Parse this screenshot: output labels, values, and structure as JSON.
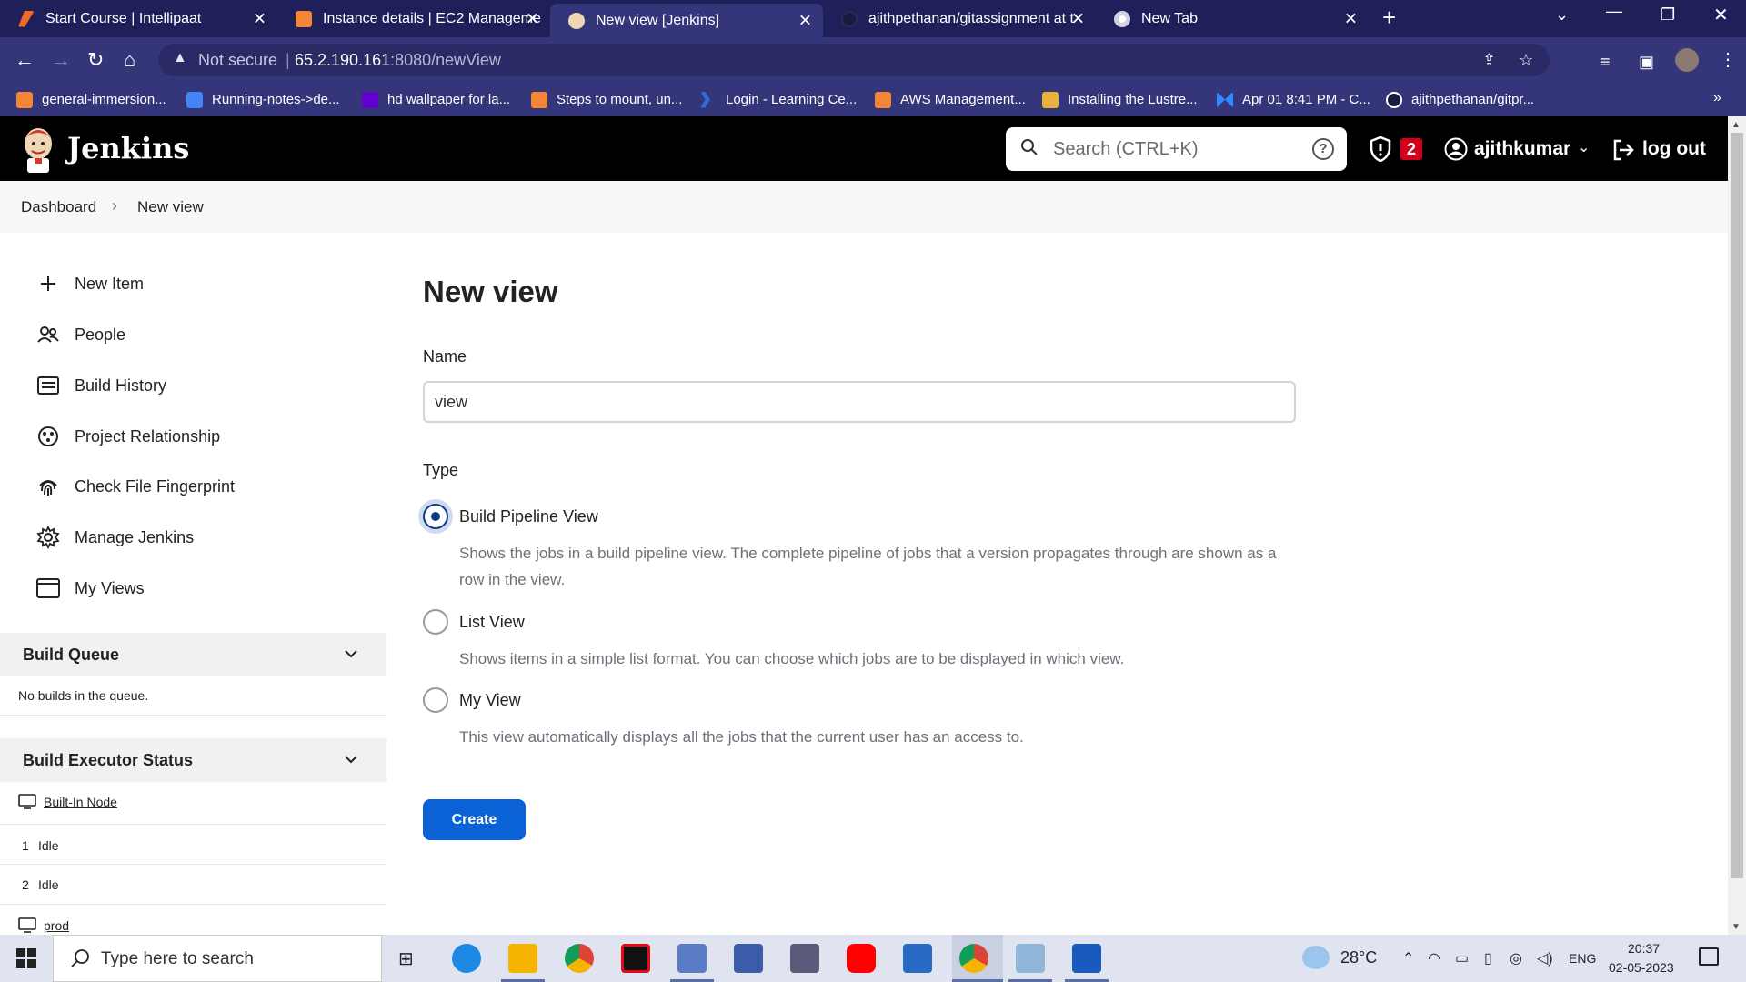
{
  "browser": {
    "tabs": [
      {
        "title": "Start Course | Intellipaat",
        "active": false,
        "icon": "intellipaat-icon"
      },
      {
        "title": "Instance details | EC2 Manageme",
        "active": false,
        "icon": "aws-icon"
      },
      {
        "title": "New view [Jenkins]",
        "active": true,
        "icon": "jenkins-icon"
      },
      {
        "title": "ajithpethanan/gitassignment at t",
        "active": false,
        "icon": "github-icon"
      },
      {
        "title": "New Tab",
        "active": false,
        "icon": "chrome-icon"
      }
    ],
    "address": {
      "security": "Not secure",
      "host": "65.2.190.161",
      "path": ":8080/newView"
    },
    "bookmarks": [
      {
        "label": "general-immersion...",
        "icon": "aws-icon"
      },
      {
        "label": "Running-notes->de...",
        "icon": "docs-icon"
      },
      {
        "label": "hd wallpaper for la...",
        "icon": "yahoo-icon"
      },
      {
        "label": "Steps to mount, un...",
        "icon": "aws-icon"
      },
      {
        "label": "Login - Learning Ce...",
        "icon": "x-icon"
      },
      {
        "label": "AWS Management...",
        "icon": "aws-icon"
      },
      {
        "label": "Installing the Lustre...",
        "icon": "package-icon"
      },
      {
        "label": "Apr 01 8:41 PM - C...",
        "icon": "zoom-icon"
      },
      {
        "label": "ajithpethanan/gitpr...",
        "icon": "github-icon"
      }
    ]
  },
  "jenkins": {
    "title": "Jenkins",
    "search_placeholder": "Search (CTRL+K)",
    "security_count": "2",
    "username": "ajithkumar",
    "logout": "log out"
  },
  "breadcrumb": [
    "Dashboard",
    "New view"
  ],
  "sidebar": {
    "items": [
      {
        "label": "New Item",
        "icon": "plus-icon"
      },
      {
        "label": "People",
        "icon": "people-icon"
      },
      {
        "label": "Build History",
        "icon": "history-icon"
      },
      {
        "label": "Project Relationship",
        "icon": "relationship-icon"
      },
      {
        "label": "Check File Fingerprint",
        "icon": "fingerprint-icon"
      },
      {
        "label": "Manage Jenkins",
        "icon": "gear-icon"
      },
      {
        "label": "My Views",
        "icon": "window-icon"
      }
    ],
    "build_queue": {
      "title": "Build Queue",
      "empty": "No builds in the queue."
    },
    "executors": {
      "title": "Build Executor Status",
      "nodes": [
        "Built-In Node",
        "prod"
      ],
      "slots": [
        {
          "num": "1",
          "status": "Idle"
        },
        {
          "num": "2",
          "status": "Idle"
        }
      ]
    }
  },
  "main": {
    "title": "New view",
    "name_label": "Name",
    "name_value": "view",
    "type_label": "Type",
    "options": [
      {
        "label": "Build Pipeline View",
        "checked": true,
        "desc": "Shows the jobs in a build pipeline view. The complete pipeline of jobs that a version propagates through are shown as a row in the view."
      },
      {
        "label": "List View",
        "checked": false,
        "desc": "Shows items in a simple list format. You can choose which jobs are to be displayed in which view."
      },
      {
        "label": "My View",
        "checked": false,
        "desc": "This view automatically displays all the jobs that the current user has an access to."
      }
    ],
    "create_label": "Create"
  },
  "taskbar": {
    "search_placeholder": "Type here to search",
    "weather": "28°C",
    "language": "ENG",
    "time": "20:37",
    "date": "02-05-2023"
  },
  "colors": {
    "accent": "#0b62d6",
    "radio": "#0b3c8a",
    "chrome": "#35357a",
    "header": "#000000"
  }
}
